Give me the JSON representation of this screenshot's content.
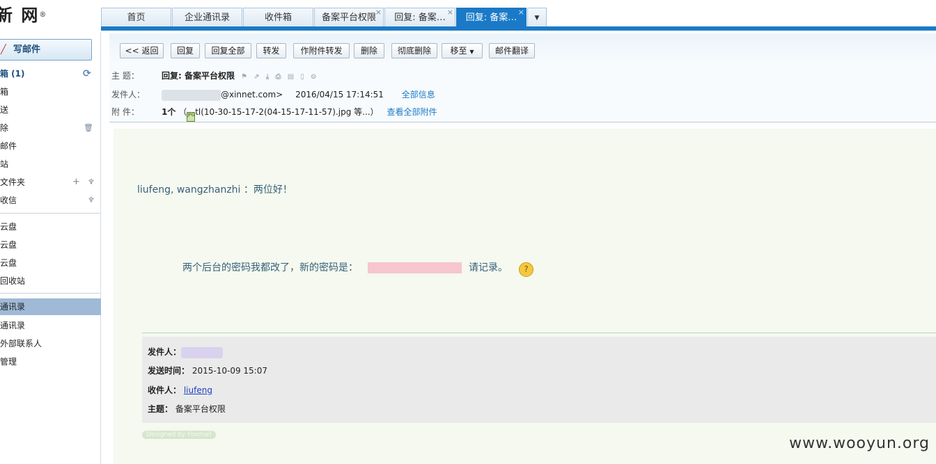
{
  "logo": {
    "text": "新 网",
    "mark": "®"
  },
  "tabs": [
    {
      "label": "首页"
    },
    {
      "label": "企业通讯录"
    },
    {
      "label": "收件箱"
    },
    {
      "label": "备案平台权限",
      "close": "×"
    },
    {
      "label": "回复: 备案…",
      "close": "×"
    },
    {
      "label": "回复: 备案…",
      "close": "×",
      "active": true
    }
  ],
  "tab_more": "▼",
  "sidebar": {
    "compose": "写邮件",
    "items": [
      {
        "label": "箱 (1)"
      },
      {
        "label": "箱"
      },
      {
        "label": "送"
      },
      {
        "label": "除"
      },
      {
        "label": "邮件"
      },
      {
        "label": "站"
      },
      {
        "label": "文件夹"
      },
      {
        "label": "收信"
      },
      {
        "label": "云盘"
      },
      {
        "label": "云盘"
      },
      {
        "label": "云盘"
      },
      {
        "label": "回收站"
      },
      {
        "label": "通讯录"
      },
      {
        "label": "通讯录"
      },
      {
        "label": "外部联系人"
      },
      {
        "label": "管理"
      }
    ]
  },
  "toolbar": {
    "back": "<< 返回",
    "reply": "回复",
    "reply_all": "回复全部",
    "forward": "转发",
    "forward_attach": "作附件转发",
    "delete": "删除",
    "delete_perm": "彻底删除",
    "move_to": "移至",
    "translate": "邮件翻译"
  },
  "header": {
    "subject_label": "主    题：",
    "subject": "回复: 备案平台权限",
    "sender_label": "发件人：",
    "sender_email": "@xinnet.com>",
    "sent_time": "2016/04/15 17:14:51",
    "all_info": "全部信息",
    "attach_label": "附    件：",
    "attach_count": "1个",
    "attach_paren_open": "（",
    "attach_name": "tl(10-30-15-17-2(04-15-17-11-57).jpg 等...",
    "attach_paren_close": "）",
    "view_all_attach": "查看全部附件"
  },
  "body": {
    "greeting": "liufeng, wangzhanzhi ：两位好！",
    "pw_text_before": "两个后台的密码我都改了，新的密码是：",
    "pw_text_after": "请记录。",
    "quote": {
      "from_label": "发件人：",
      "sent_label": "发送时间：",
      "sent_value": "2015-10-09 15:07",
      "to_label": "收件人：",
      "to_value": "liufeng",
      "subject_label": "主题：",
      "subject_value": "备案平台权限"
    },
    "designed_by": "Designed by Foxmail"
  },
  "watermark": "www.wooyun.org",
  "colors": {
    "accent": "#1a7ac7",
    "body_bg": "#f5f9ef",
    "link": "#1a7ac7",
    "sidebar_selected": "#9fb9d6"
  }
}
